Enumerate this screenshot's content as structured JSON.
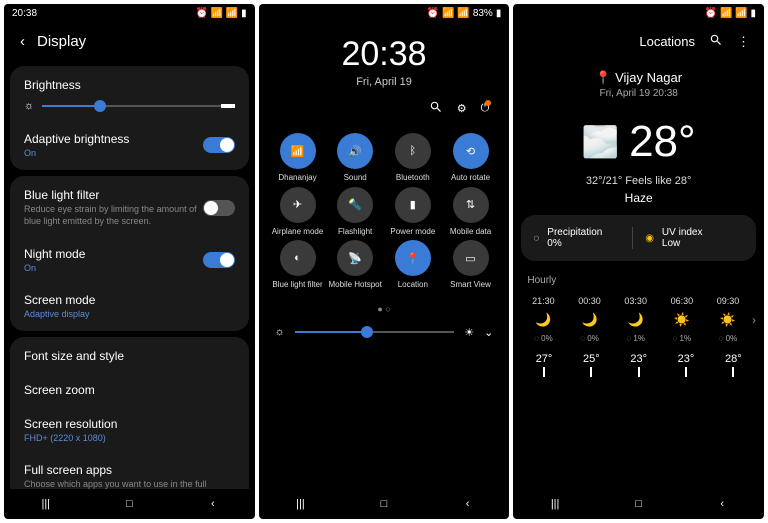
{
  "status": {
    "time": "20:38",
    "battery": "83%"
  },
  "p1": {
    "title": "Display",
    "brightness": "Brightness",
    "adaptive": {
      "title": "Adaptive brightness",
      "sub": "On"
    },
    "bluelight": {
      "title": "Blue light filter",
      "desc": "Reduce eye strain by limiting the amount of blue light emitted by the screen."
    },
    "night": {
      "title": "Night mode",
      "sub": "On"
    },
    "screenmode": {
      "title": "Screen mode",
      "sub": "Adaptive display"
    },
    "font": "Font size and style",
    "zoom": "Screen zoom",
    "res": {
      "title": "Screen resolution",
      "sub": "FHD+ (2220 x 1080)"
    },
    "fullscreen": {
      "title": "Full screen apps",
      "desc": "Choose which apps you want to use in the full screen"
    }
  },
  "p2": {
    "clock": "20:38",
    "date": "Fri, April 19",
    "tiles": [
      {
        "label": "Dhananjay",
        "on": true,
        "icon": "wifi"
      },
      {
        "label": "Sound",
        "on": true,
        "icon": "sound"
      },
      {
        "label": "Bluetooth",
        "on": false,
        "icon": "bt"
      },
      {
        "label": "Auto rotate",
        "on": true,
        "icon": "rotate"
      },
      {
        "label": "Airplane mode",
        "on": false,
        "icon": "plane"
      },
      {
        "label": "Flashlight",
        "on": false,
        "icon": "flash"
      },
      {
        "label": "Power mode",
        "on": false,
        "icon": "power"
      },
      {
        "label": "Mobile data",
        "on": false,
        "icon": "data"
      },
      {
        "label": "Blue light filter",
        "on": false,
        "icon": "blf"
      },
      {
        "label": "Mobile Hotspot",
        "on": false,
        "icon": "hotspot"
      },
      {
        "label": "Location",
        "on": true,
        "icon": "loc"
      },
      {
        "label": "Smart View",
        "on": false,
        "icon": "cast"
      }
    ]
  },
  "p3": {
    "header": "Locations",
    "locname": "Vijay Nagar",
    "locdate": "Fri, April 19 20:38",
    "temp": "28°",
    "hilo": "32°/21° Feels like 28°",
    "cond": "Haze",
    "precip": {
      "label": "Precipitation",
      "val": "0%"
    },
    "uv": {
      "label": "UV index",
      "val": "Low"
    },
    "hourly_label": "Hourly",
    "hours": [
      {
        "t": "21:30",
        "pop": "0%",
        "temp": "27°",
        "icon": "🌙"
      },
      {
        "t": "00:30",
        "pop": "0%",
        "temp": "25°",
        "icon": "🌙"
      },
      {
        "t": "03:30",
        "pop": "1%",
        "temp": "23°",
        "icon": "🌙"
      },
      {
        "t": "06:30",
        "pop": "1%",
        "temp": "23°",
        "icon": "☀️"
      },
      {
        "t": "09:30",
        "pop": "0%",
        "temp": "28°",
        "icon": "☀️"
      }
    ]
  }
}
